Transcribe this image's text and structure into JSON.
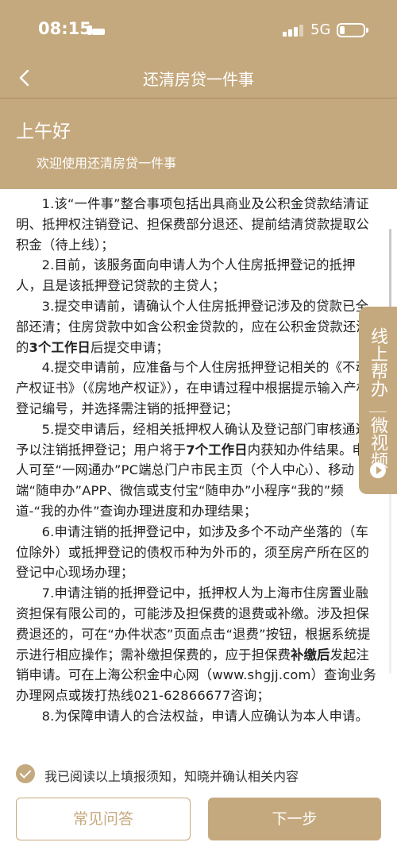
{
  "status_bar": {
    "time": "08:15",
    "network": "5G"
  },
  "nav": {
    "title": "还清房贷一件事"
  },
  "header": {
    "greeting": "上午好",
    "welcome": "欢迎使用还清房贷一件事"
  },
  "notice": {
    "p1": "1.该“一件事”整合事项包括出具商业及公积金贷款结清证明、抵押权注销登记、担保费部分退还、提前结清贷款提取公积金（待上线）；",
    "p2": "2.目前，该服务面向申请人为个人住房抵押登记的抵押人，且是该抵押登记贷款的主贷人；",
    "p3a": "3.提交申请前，请确认个人住房抵押登记涉及的贷款已全部还清；住房贷款中如含公积金贷款的，应在公积金贷款还清的",
    "p3b": "3个工作日",
    "p3c": "后提交申请；",
    "p4": "4.提交申请前，应准备与个人住房抵押登记相关的《不动产权证书》（《房地产权证》），在申请过程中根据提示输入产权登记编号，并选择需注销的抵押登记；",
    "p5a": "5.提交申请后，经相关抵押权人确认及登记部门审核通过予以注销抵押登记；用户将于",
    "p5b": "7个工作日",
    "p5c": "内获知办件结果。申请人可至“一网通办”PC端总门户市民主页（个人中心）、移动端“随申办”APP、微信或支付宝“随申办”小程序“我的”频道-“我的办件”查询办理进度和办理结果；",
    "p6": "6.申请注销的抵押登记中，如涉及多个不动产坐落的（车位除外）或抵押登记的债权币种为外币的，须至房产所在区的登记中心现场办理；",
    "p7a": "7.申请注销的抵押登记中，抵押权人为上海市住房置业融资担保有限公司的，可能涉及担保费的退费或补缴。涉及担保费退还的，可在“办件状态”页面点击“退费”按钮，根据系统提示进行相应操作；需补缴担保费的，应于担保费",
    "p7b": "补缴后",
    "p7c": "发起注销申请。可在上海公积金中心网（www.shgjj.com）查询业务办理网点或拨打热线021-62866677咨询；",
    "p8": "8.为保障申请人的合法权益，申请人应确认为本人申请。"
  },
  "float_help": {
    "label1": "线上帮办",
    "label2": "微视频"
  },
  "footer": {
    "agree_text": "我已阅读以上填报须知，知晓并确认相关内容",
    "faq_label": "常见问答",
    "next_label": "下一步"
  },
  "colors": {
    "brand": "#c5a97e",
    "text": "#222222"
  },
  "icons": [
    "back-icon",
    "bed-icon",
    "signal-icon",
    "battery-icon",
    "check-icon",
    "play-icon"
  ]
}
